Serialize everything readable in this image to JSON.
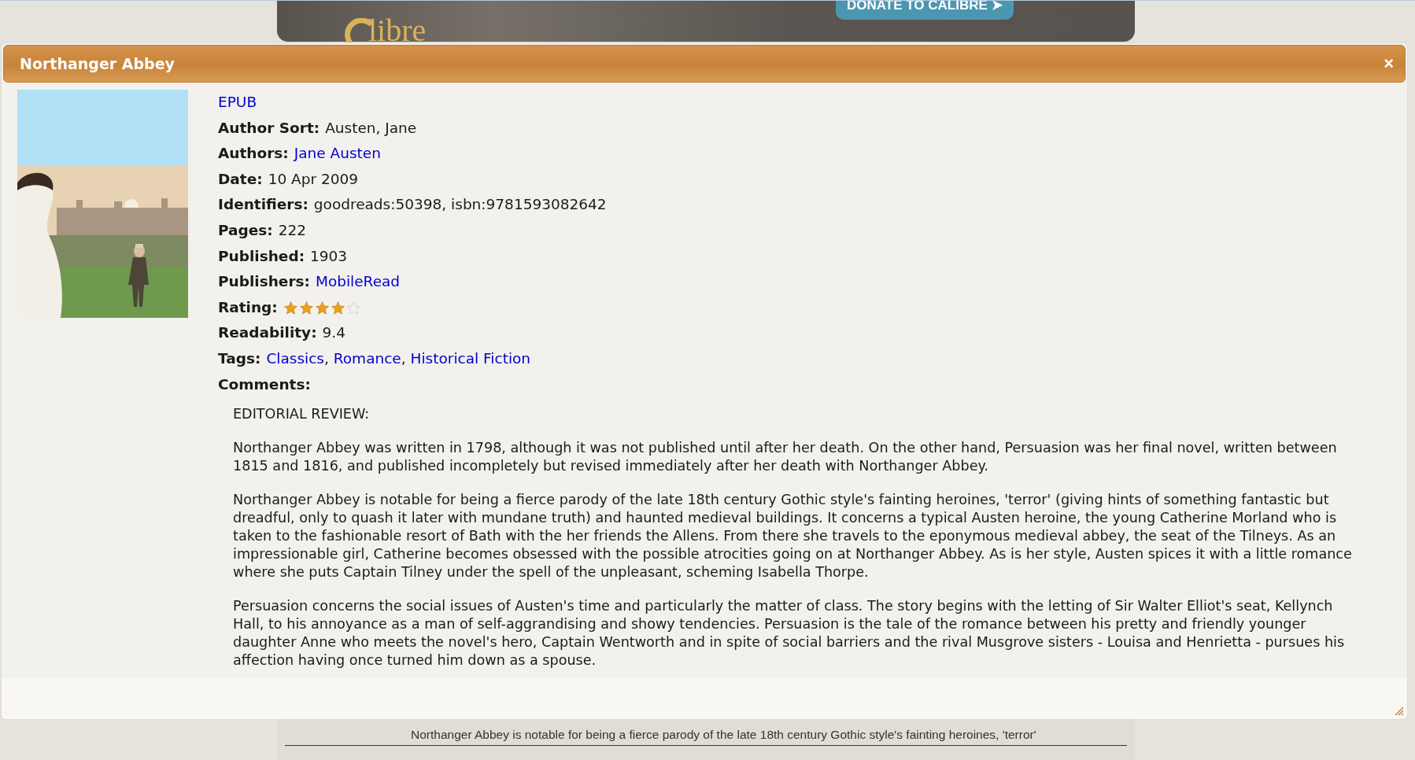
{
  "background_page": {
    "logo_text": "libre",
    "donate_button": "DONATE TO CALIBRE ➤",
    "row_comment": "Northanger Abbey is notable for being a fierce parody of the late 18th century Gothic style's fainting heroines, 'terror'"
  },
  "dialog": {
    "title": "Northanger Abbey",
    "close": "×",
    "format_link": "EPUB",
    "fields": [
      {
        "kind": "text",
        "label": "Author Sort:",
        "value": "Austen, Jane"
      },
      {
        "kind": "links",
        "label": "Authors:",
        "links": [
          "Jane Austen"
        ]
      },
      {
        "kind": "text",
        "label": "Date:",
        "value": "10 Apr 2009"
      },
      {
        "kind": "text",
        "label": "Identifiers:",
        "value": "goodreads:50398, isbn:9781593082642"
      },
      {
        "kind": "text",
        "label": "Pages:",
        "value": "222"
      },
      {
        "kind": "text",
        "label": "Published:",
        "value": "1903"
      },
      {
        "kind": "links",
        "label": "Publishers:",
        "links": [
          "MobileRead"
        ]
      },
      {
        "kind": "rating",
        "label": "Rating:",
        "stars": 4
      },
      {
        "kind": "text",
        "label": "Readability:",
        "value": "9.4"
      },
      {
        "kind": "links",
        "label": "Tags:",
        "links": [
          "Classics",
          "Romance",
          "Historical Fiction"
        ],
        "separator": ", "
      },
      {
        "kind": "heading",
        "label": "Comments:"
      }
    ],
    "comments": [
      "EDITORIAL REVIEW:",
      "Northanger Abbey was written in 1798, although it was not published until after her death. On the other hand, Persuasion was her final novel, written between 1815 and 1816, and published incompletely but revised immediately after her death with Northanger Abbey.",
      "Northanger Abbey is notable for being a fierce parody of the late 18th century Gothic style's fainting heroines, 'terror' (giving hints of something fantastic but dreadful, only to quash it later with mundane truth) and haunted medieval buildings. It concerns a typical Austen heroine, the young Catherine Morland who is taken to the fashionable resort of Bath with the her friends the Allens. From there she travels to the eponymous medieval abbey, the seat of the Tilneys. As an impressionable girl, Catherine becomes obsessed with the possible atrocities going on at Northanger Abbey. As is her style, Austen spices it with a little romance where she puts Captain Tilney under the spell of the unpleasant, scheming Isabella Thorpe.",
      "Persuasion concerns the social issues of Austen's time and particularly the matter of class. The story begins with the letting of Sir Walter Elliot's seat, Kellynch Hall, to his annoyance as a man of self-aggrandising and showy tendencies. Persuasion is the tale of the romance between his pretty and friendly younger daughter Anne who meets the novel's hero, Captain Wentworth and in spite of social barriers and the rival Musgrove sisters - Louisa and Henrietta - pursues his affection having once turned him down as a spouse."
    ]
  }
}
